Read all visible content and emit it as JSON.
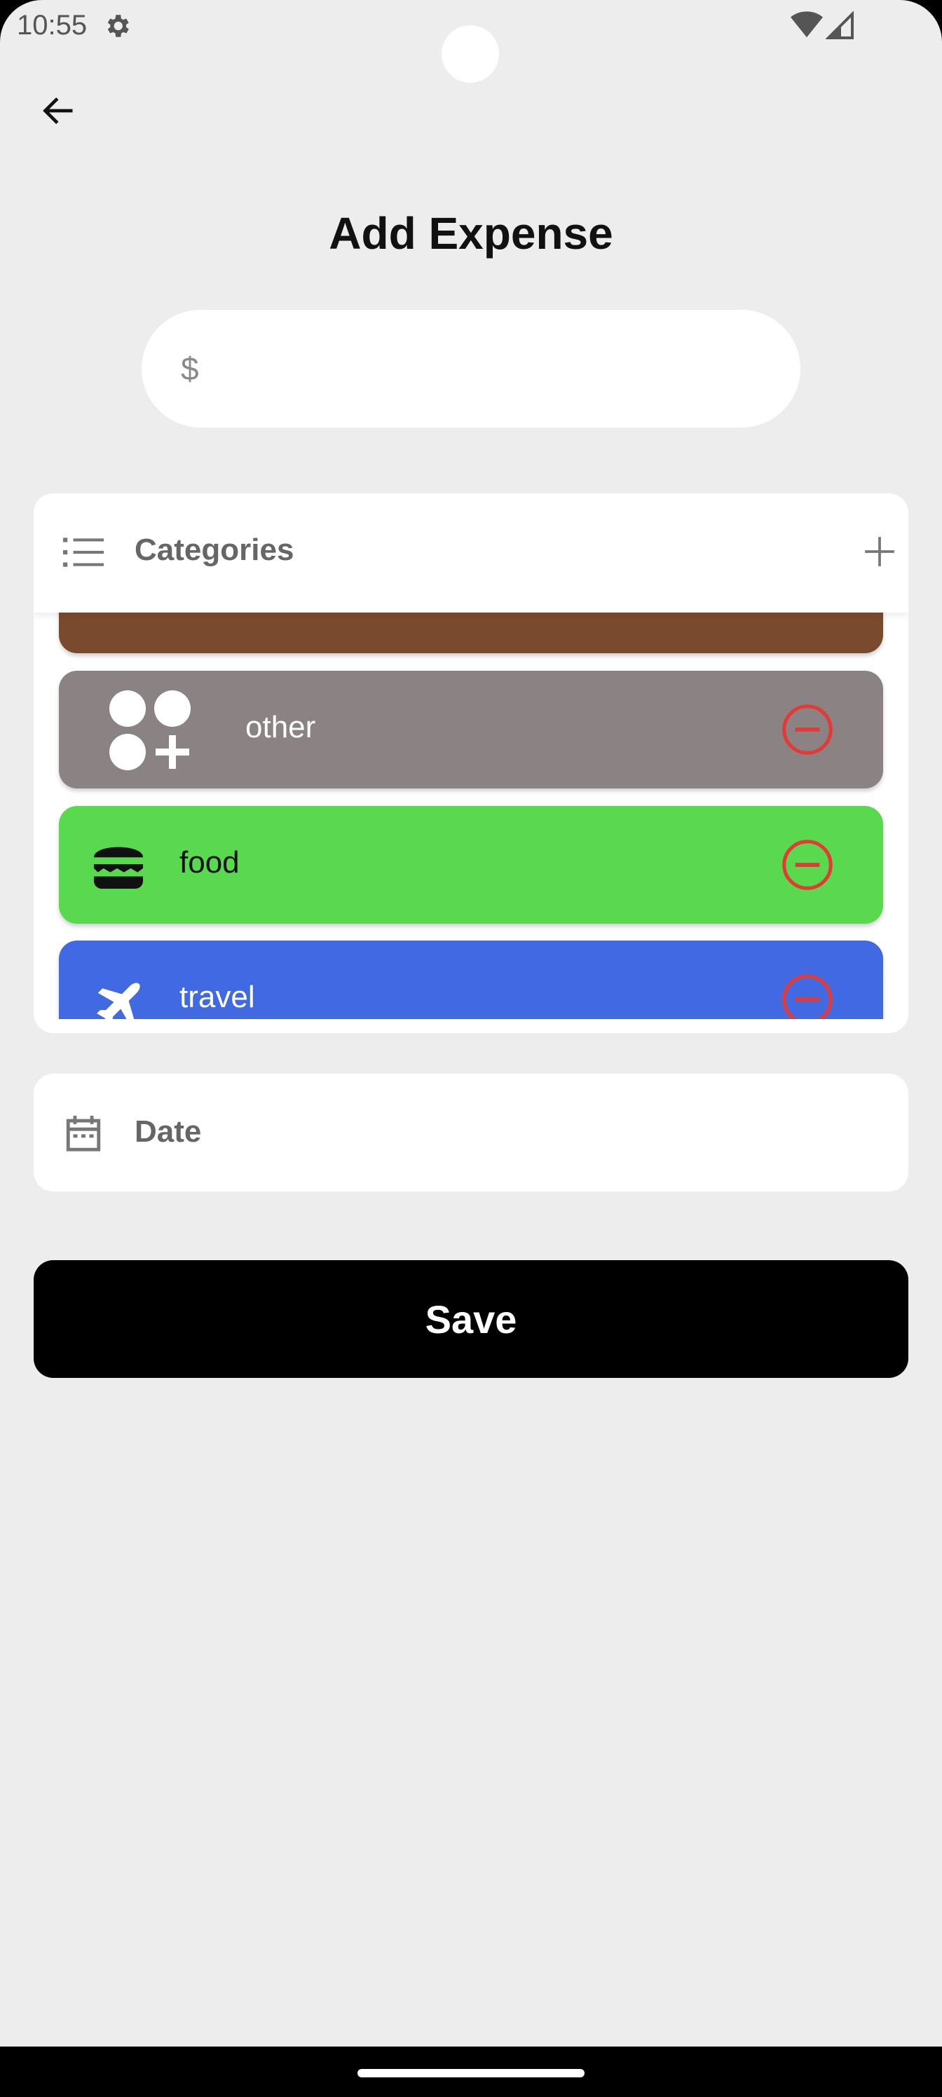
{
  "status_bar": {
    "time": "10:55",
    "icons": [
      "gear-icon",
      "wifi-icon",
      "signal-icon"
    ]
  },
  "header": {
    "back_icon": "arrow-left-icon",
    "title": "Add Expense"
  },
  "amount": {
    "prefix": "$",
    "value": ""
  },
  "categories": {
    "label": "Categories",
    "header_icon": "list-icon",
    "add_icon": "plus-icon",
    "items": [
      {
        "label": "",
        "color": "#7a4a2e",
        "partial": true
      },
      {
        "label": "other",
        "icon": "apps-add-icon",
        "color": "#8b8383",
        "text_color": "#ffffff"
      },
      {
        "label": "food",
        "icon": "burger-icon",
        "color": "#59d94e",
        "text_color": "#111111"
      },
      {
        "label": "travel",
        "icon": "airplane-icon",
        "color": "#4169e1",
        "text_color": "#ffffff"
      }
    ],
    "remove_icon": "minus-circle-icon",
    "remove_color": "#e53935"
  },
  "date": {
    "icon": "calendar-icon",
    "label": "Date"
  },
  "save": {
    "label": "Save"
  }
}
